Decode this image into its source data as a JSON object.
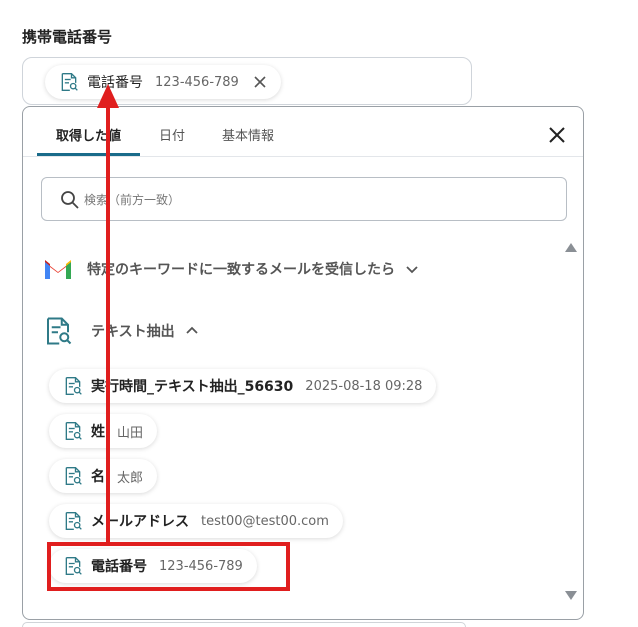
{
  "field": {
    "label": "携帯電話番号",
    "chip": {
      "name": "電話番号",
      "value": "123-456-789"
    }
  },
  "tabs": [
    {
      "label": "取得した値",
      "active": true
    },
    {
      "label": "日付",
      "active": false
    },
    {
      "label": "基本情報",
      "active": false
    }
  ],
  "search": {
    "placeholder": "検索（前方一致）",
    "value": ""
  },
  "groups": [
    {
      "label": "特定のキーワードに一致するメールを受信したら",
      "icon": "gmail-icon",
      "expanded": false
    },
    {
      "label": "テキスト抽出",
      "icon": "document-search-icon",
      "expanded": true
    }
  ],
  "items": [
    {
      "name": "実行時間_テキスト抽出_56630",
      "value": "2025-08-18 09:28"
    },
    {
      "name": "姓",
      "value": "山田"
    },
    {
      "name": "名",
      "value": "太郎"
    },
    {
      "name": "メールアドレス",
      "value": "test00@test00.com"
    },
    {
      "name": "電話番号",
      "value": "123-456-789"
    }
  ],
  "colors": {
    "accent": "#1a6b8a",
    "highlight": "#e01e1e",
    "icon": "#2f7a87"
  }
}
